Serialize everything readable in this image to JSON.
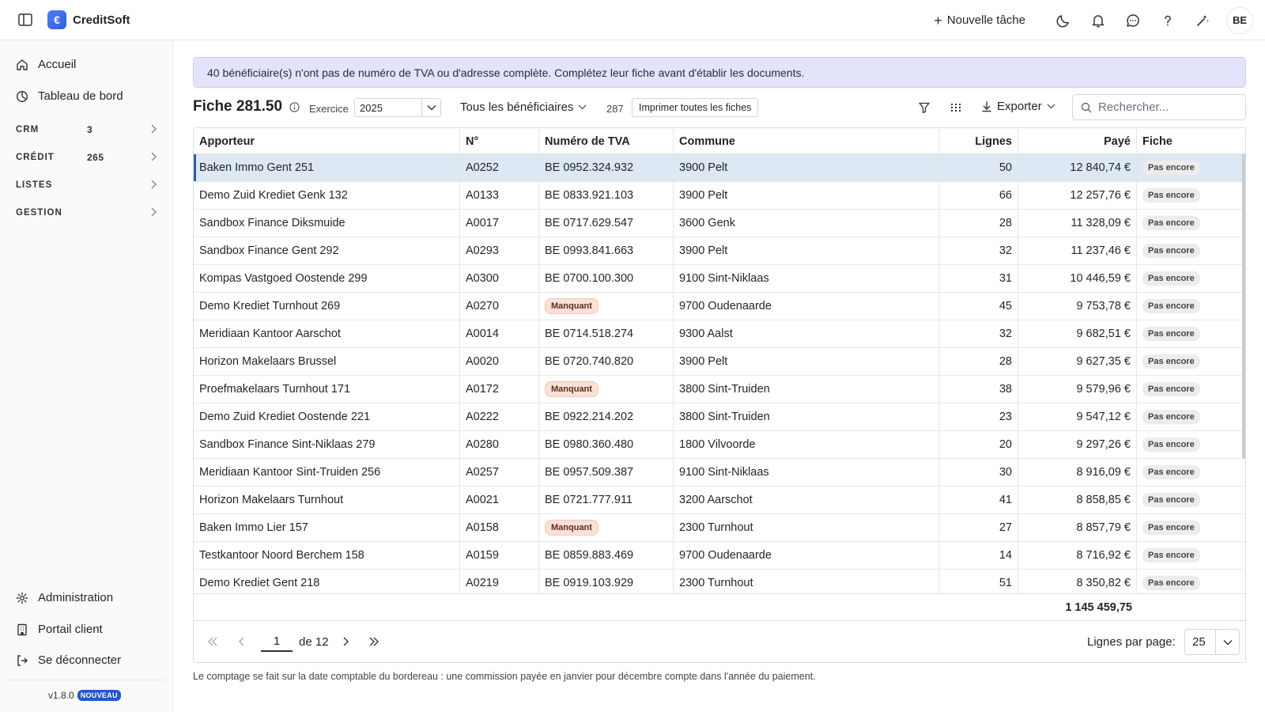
{
  "app": {
    "name": "CreditSoft",
    "logo_glyph": "€"
  },
  "topbar": {
    "new_task_label": "Nouvelle tâche",
    "avatar_initials": "BE",
    "icons": [
      "moon-icon",
      "bell-icon",
      "chat-icon",
      "help-icon",
      "magic-icon"
    ]
  },
  "sidebar": {
    "home": "Accueil",
    "dashboard": "Tableau de bord",
    "sections": [
      {
        "label": "CRM",
        "count": "3"
      },
      {
        "label": "CRÉDIT",
        "count": "265"
      },
      {
        "label": "LISTES",
        "count": ""
      },
      {
        "label": "GESTION",
        "count": ""
      }
    ],
    "admin": "Administration",
    "client_portal": "Portail client",
    "logout": "Se déconnecter",
    "version": "v1.8.0",
    "new_badge": "NOUVEAU"
  },
  "alert": {
    "text": "40 bénéficiaire(s) n'ont pas de numéro de TVA ou d'adresse complète. Complétez leur fiche avant d'établir les documents."
  },
  "toolbar": {
    "title": "Fiche 281.50",
    "exercise_label": "Exercice",
    "exercise_value": "2025",
    "beneficiaries_filter": "Tous les bénéficiaires",
    "total_count": "287",
    "print_all_label": "Imprimer toutes les fiches",
    "export_label": "Exporter",
    "search_placeholder": "Rechercher..."
  },
  "table": {
    "columns": [
      "Apporteur",
      "N°",
      "Numéro de TVA",
      "Commune",
      "Lignes",
      "Payé",
      "Fiche"
    ],
    "rows": [
      {
        "apporteur": "Baken Immo Gent 251",
        "num": "A0252",
        "tva": "BE 0952.324.932",
        "tva_missing": false,
        "commune": "3900 Pelt",
        "lignes": "50",
        "paye": "12 840,74 €",
        "fiche": "Pas encore",
        "selected": true
      },
      {
        "apporteur": "Demo Zuid Krediet Genk 132",
        "num": "A0133",
        "tva": "BE 0833.921.103",
        "tva_missing": false,
        "commune": "3900 Pelt",
        "lignes": "66",
        "paye": "12 257,76 €",
        "fiche": "Pas encore"
      },
      {
        "apporteur": "Sandbox Finance Diksmuide",
        "num": "A0017",
        "tva": "BE 0717.629.547",
        "tva_missing": false,
        "commune": "3600 Genk",
        "lignes": "28",
        "paye": "11 328,09 €",
        "fiche": "Pas encore"
      },
      {
        "apporteur": "Sandbox Finance Gent 292",
        "num": "A0293",
        "tva": "BE 0993.841.663",
        "tva_missing": false,
        "commune": "3900 Pelt",
        "lignes": "32",
        "paye": "11 237,46 €",
        "fiche": "Pas encore"
      },
      {
        "apporteur": "Kompas Vastgoed Oostende 299",
        "num": "A0300",
        "tva": "BE 0700.100.300",
        "tva_missing": false,
        "commune": "9100 Sint-Niklaas",
        "lignes": "31",
        "paye": "10 446,59 €",
        "fiche": "Pas encore"
      },
      {
        "apporteur": "Demo Krediet Turnhout 269",
        "num": "A0270",
        "tva": "Manquant",
        "tva_missing": true,
        "commune": "9700 Oudenaarde",
        "lignes": "45",
        "paye": "9 753,78 €",
        "fiche": "Pas encore"
      },
      {
        "apporteur": "Meridiaan Kantoor Aarschot",
        "num": "A0014",
        "tva": "BE 0714.518.274",
        "tva_missing": false,
        "commune": "9300 Aalst",
        "lignes": "32",
        "paye": "9 682,51 €",
        "fiche": "Pas encore"
      },
      {
        "apporteur": "Horizon Makelaars Brussel",
        "num": "A0020",
        "tva": "BE 0720.740.820",
        "tva_missing": false,
        "commune": "3900 Pelt",
        "lignes": "28",
        "paye": "9 627,35 €",
        "fiche": "Pas encore"
      },
      {
        "apporteur": "Proefmakelaars Turnhout 171",
        "num": "A0172",
        "tva": "Manquant",
        "tva_missing": true,
        "commune": "3800 Sint-Truiden",
        "lignes": "38",
        "paye": "9 579,96 €",
        "fiche": "Pas encore"
      },
      {
        "apporteur": "Demo Zuid Krediet Oostende 221",
        "num": "A0222",
        "tva": "BE 0922.214.202",
        "tva_missing": false,
        "commune": "3800 Sint-Truiden",
        "lignes": "23",
        "paye": "9 547,12 €",
        "fiche": "Pas encore"
      },
      {
        "apporteur": "Sandbox Finance Sint-Niklaas 279",
        "num": "A0280",
        "tva": "BE 0980.360.480",
        "tva_missing": false,
        "commune": "1800 Vilvoorde",
        "lignes": "20",
        "paye": "9 297,26 €",
        "fiche": "Pas encore"
      },
      {
        "apporteur": "Meridiaan Kantoor Sint-Truiden 256",
        "num": "A0257",
        "tva": "BE 0957.509.387",
        "tva_missing": false,
        "commune": "9100 Sint-Niklaas",
        "lignes": "30",
        "paye": "8 916,09 €",
        "fiche": "Pas encore"
      },
      {
        "apporteur": "Horizon Makelaars Turnhout",
        "num": "A0021",
        "tva": "BE 0721.777.911",
        "tva_missing": false,
        "commune": "3200 Aarschot",
        "lignes": "41",
        "paye": "8 858,85 €",
        "fiche": "Pas encore"
      },
      {
        "apporteur": "Baken Immo Lier 157",
        "num": "A0158",
        "tva": "Manquant",
        "tva_missing": true,
        "commune": "2300 Turnhout",
        "lignes": "27",
        "paye": "8 857,79 €",
        "fiche": "Pas encore"
      },
      {
        "apporteur": "Testkantoor Noord Berchem 158",
        "num": "A0159",
        "tva": "BE 0859.883.469",
        "tva_missing": false,
        "commune": "9700 Oudenaarde",
        "lignes": "14",
        "paye": "8 716,92 €",
        "fiche": "Pas encore"
      },
      {
        "apporteur": "Demo Krediet Gent 218",
        "num": "A0219",
        "tva": "BE 0919.103.929",
        "tva_missing": false,
        "commune": "2300 Turnhout",
        "lignes": "51",
        "paye": "8 350,82 €",
        "fiche": "Pas encore"
      }
    ],
    "total_paid": "1 145 459,75"
  },
  "pager": {
    "current_page": "1",
    "of_label": "de 12",
    "rows_per_page_label": "Lignes par page:",
    "rows_per_page_value": "25"
  },
  "footnote": "Le comptage se fait sur la date comptable du bordereau : une commission payée en janvier pour décembre compte dans l'année du paiement.",
  "colors": {
    "accent": "#2c5fb3",
    "alert_bg": "#e4e3fc",
    "selected_row": "#dde8f4",
    "missing_pill": "#fbe0d6"
  }
}
